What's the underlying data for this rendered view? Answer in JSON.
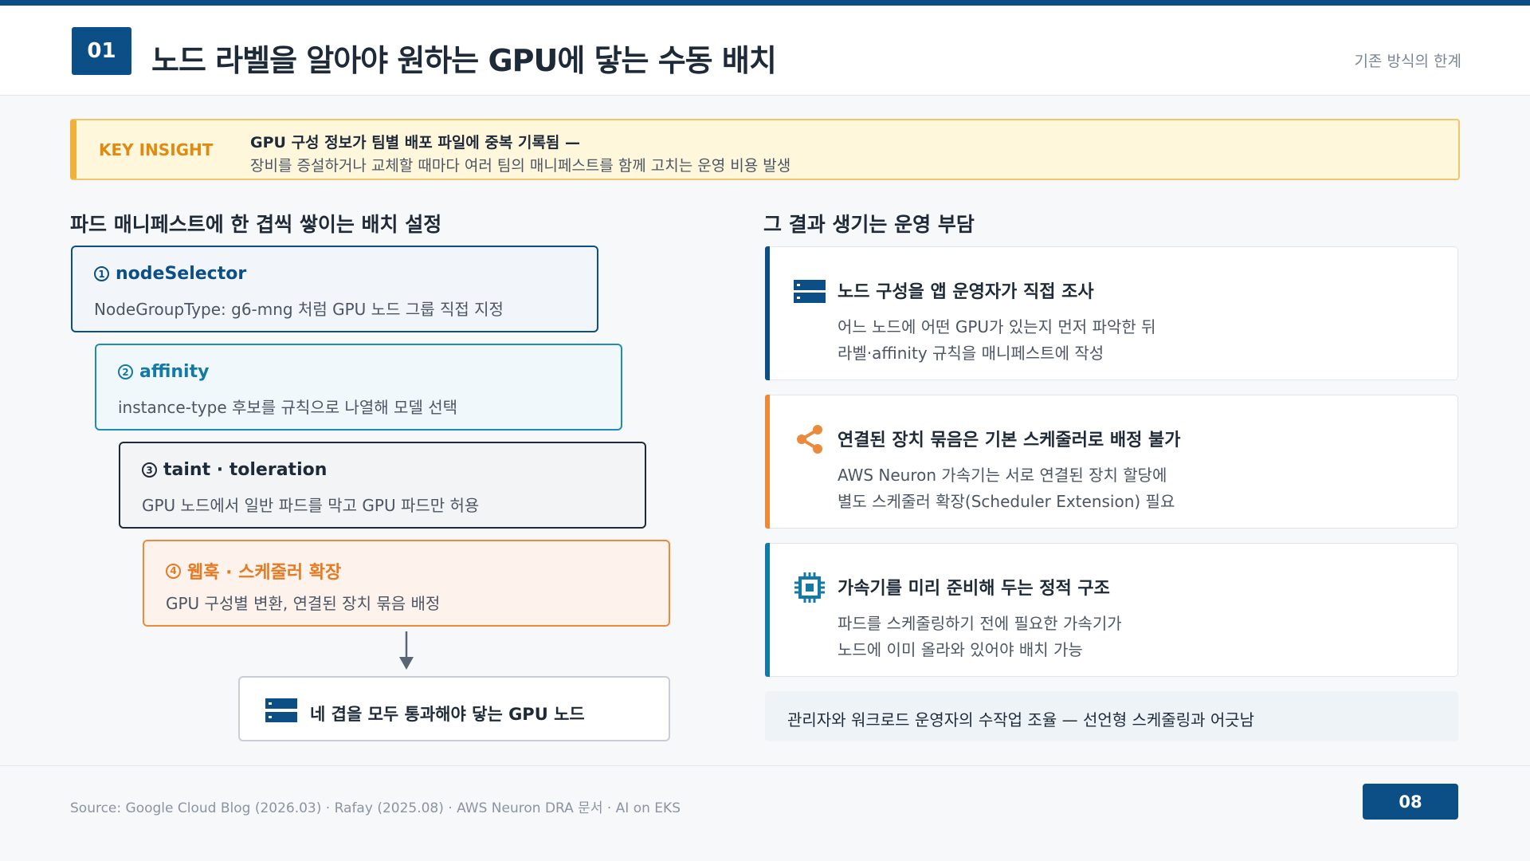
{
  "header": {
    "number": "01",
    "title": "노드 라벨을 알아야 원하는 GPU에 닿는 수동 배치",
    "section": "기존 방식의 한계"
  },
  "insight": {
    "tag": "KEY INSIGHT",
    "title": "GPU 구성 정보가 팀별 배포 파일에 중복 기록됨 —",
    "desc": "장비를 증설하거나 교체할 때마다 여러 팀의 매니페스트를 함께 고치는 운영 비용 발생"
  },
  "left": {
    "title": "파드 매니페스트에 한 겹씩 쌓이는 배치 설정",
    "steps": [
      {
        "num": "1",
        "title": "nodeSelector",
        "desc": "NodeGroupType: g6-mng 처럼 GPU 노드 그룹 직접 지정"
      },
      {
        "num": "2",
        "title": "affinity",
        "desc": "instance-type 후보를 규칙으로 나열해 모델 선택"
      },
      {
        "num": "3",
        "title": "taint · toleration",
        "desc": "GPU 노드에서 일반 파드를 막고 GPU 파드만 허용"
      },
      {
        "num": "4",
        "title": "웹훅 · 스케줄러 확장",
        "desc": "GPU 구성별 변환, 연결된 장치 묶음 배정"
      }
    ],
    "node": {
      "icon": "server-icon",
      "label": "네 겹을 모두 통과해야 닿는 GPU 노드"
    }
  },
  "right": {
    "title": "그 결과 생기는 운영 부담",
    "cards": [
      {
        "icon": "server-icon",
        "title": "노드 구성을 앱 운영자가 직접 조사",
        "line1": "어느 노드에 어떤 GPU가 있는지 먼저 파악한 뒤",
        "line2": "라벨·affinity 규칙을 매니페스트에 작성",
        "accent": "#0b4f86"
      },
      {
        "icon": "share-icon",
        "title": "연결된 장치 묶음은 기본 스케줄러로 배정 불가",
        "line1": "AWS Neuron 가속기는 서로 연결된 장치 할당에",
        "line2": "별도 스케줄러 확장(Scheduler Extension) 필요",
        "accent": "#ec8a3c"
      },
      {
        "icon": "chip-icon",
        "title": "가속기를 미리 준비해 두는 정적 구조",
        "line1": "파드를 스케줄링하기 전에 필요한 가속기가",
        "line2": "노드에 이미 올라와 있어야 배치 가능",
        "accent": "#1379a6"
      }
    ],
    "summary": "관리자와 워크로드 운영자의 수작업 조율 — 선언형 스케줄링과 어긋남"
  },
  "footer": {
    "source": "Source: Google Cloud Blog (2026.03) · Rafay (2025.08) · AWS Neuron DRA 문서 · AI on EKS",
    "page": "08"
  }
}
